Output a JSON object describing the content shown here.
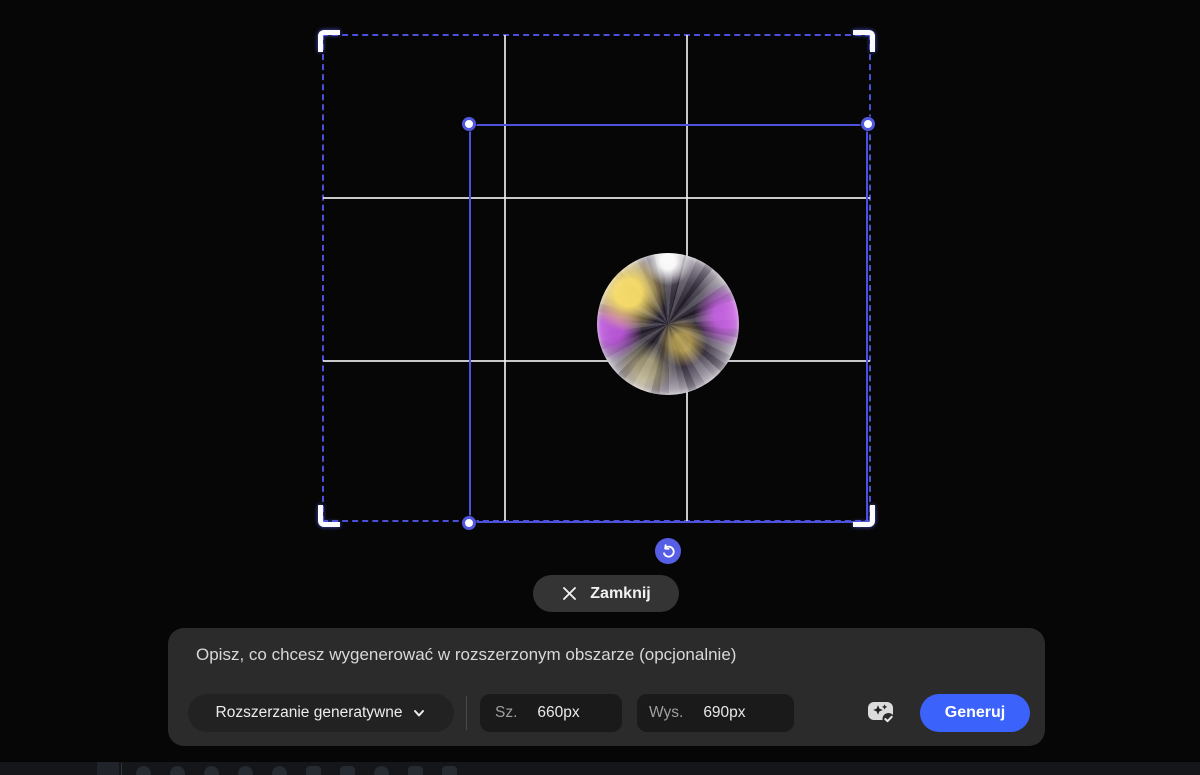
{
  "colors": {
    "accent_indigo": "#4b50d9",
    "primary_blue": "#3b63fb",
    "panel_bg": "#2b2b2b",
    "background": "#060606"
  },
  "crop_overlay": {
    "close_button": {
      "label": "Zamknij",
      "icon": "close-icon"
    },
    "rotate_handle_icon": "rotate-ccw-icon",
    "grid": "rule-of-thirds"
  },
  "prompt_panel": {
    "prompt_placeholder": "Opisz, co chcesz wygenerować w rozszerzonym obszarze (opcjonalnie)",
    "mode_dropdown": {
      "selected": "Rozszerzanie generatywne",
      "icon": "chevron-down-icon"
    },
    "width_field": {
      "label": "Sz.",
      "value": "660px"
    },
    "height_field": {
      "label": "Wys.",
      "value": "690px"
    },
    "credits_icon": "generative-credits-icon",
    "generate_button": {
      "label": "Generuj"
    }
  }
}
